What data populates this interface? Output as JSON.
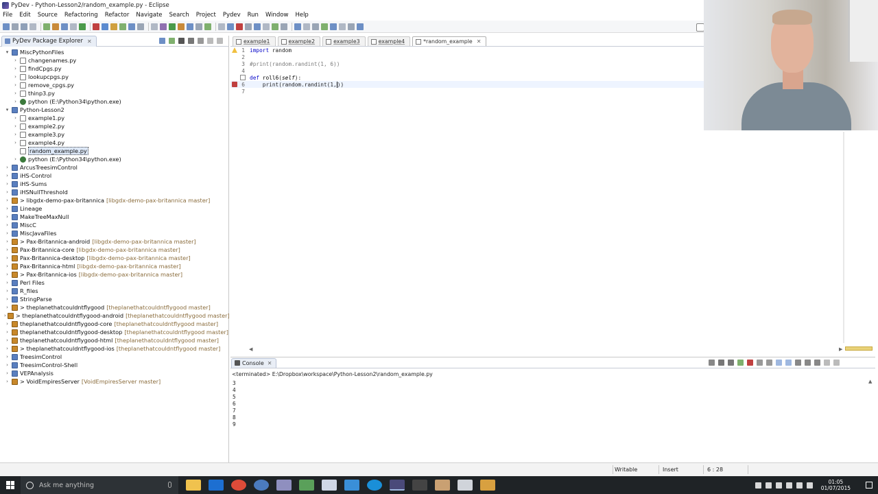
{
  "window": {
    "title": "PyDev - Python-Lesson2/random_example.py - Eclipse"
  },
  "menu": [
    "File",
    "Edit",
    "Source",
    "Refactoring",
    "Refactor",
    "Navigate",
    "Search",
    "Project",
    "Pydev",
    "Run",
    "Window",
    "Help"
  ],
  "explorer": {
    "tab_label": "PyDev Package Explorer",
    "close": "✕",
    "items": [
      {
        "label": "MiscPythonFiles",
        "type": "proj",
        "level": 0,
        "twisty": "▾",
        "branch": ""
      },
      {
        "label": "changenames.py",
        "type": "file",
        "level": 1,
        "twisty": "›",
        "branch": ""
      },
      {
        "label": "findCpgs.py",
        "type": "file",
        "level": 1,
        "twisty": "›",
        "branch": ""
      },
      {
        "label": "lookupcpgs.py",
        "type": "file",
        "level": 1,
        "twisty": "›",
        "branch": ""
      },
      {
        "label": "remove_cpgs.py",
        "type": "file",
        "level": 1,
        "twisty": "›",
        "branch": ""
      },
      {
        "label": "thinp3.py",
        "type": "file",
        "level": 1,
        "twisty": "›",
        "branch": ""
      },
      {
        "label": "python  (E:\\Python34\\python.exe)",
        "type": "interp",
        "level": 1,
        "twisty": "›",
        "branch": ""
      },
      {
        "label": "Python-Lesson2",
        "type": "proj",
        "level": 0,
        "twisty": "▾",
        "branch": ""
      },
      {
        "label": "example1.py",
        "type": "file",
        "level": 1,
        "twisty": "›",
        "branch": ""
      },
      {
        "label": "example2.py",
        "type": "file",
        "level": 1,
        "twisty": "›",
        "branch": ""
      },
      {
        "label": "example3.py",
        "type": "file",
        "level": 1,
        "twisty": "›",
        "branch": ""
      },
      {
        "label": "example4.py",
        "type": "file",
        "level": 1,
        "twisty": "›",
        "branch": ""
      },
      {
        "label": "random_example.py",
        "type": "file",
        "level": 1,
        "twisty": "",
        "branch": "",
        "selected": true
      },
      {
        "label": "python  (E:\\Python34\\python.exe)",
        "type": "interp",
        "level": 1,
        "twisty": "›",
        "branch": ""
      },
      {
        "label": "ArcusTreesimControl",
        "type": "proj",
        "level": 0,
        "twisty": "›",
        "branch": ""
      },
      {
        "label": "iHS-Control",
        "type": "proj",
        "level": 0,
        "twisty": "›",
        "branch": ""
      },
      {
        "label": "iHS-Sums",
        "type": "proj",
        "level": 0,
        "twisty": "›",
        "branch": ""
      },
      {
        "label": "iHSNullThreshold",
        "type": "proj",
        "level": 0,
        "twisty": "›",
        "branch": ""
      },
      {
        "label": "> libgdx-demo-pax-britannica",
        "type": "git",
        "level": 0,
        "twisty": "›",
        "branch": "[libgdx-demo-pax-britannica master]"
      },
      {
        "label": "Lineage",
        "type": "proj",
        "level": 0,
        "twisty": "›",
        "branch": ""
      },
      {
        "label": "MakeTreeMaxNull",
        "type": "proj",
        "level": 0,
        "twisty": "›",
        "branch": ""
      },
      {
        "label": "MiscC",
        "type": "proj",
        "level": 0,
        "twisty": "›",
        "branch": ""
      },
      {
        "label": "MiscJavaFiles",
        "type": "proj",
        "level": 0,
        "twisty": "›",
        "branch": ""
      },
      {
        "label": "> Pax-Britannica-android",
        "type": "git",
        "level": 0,
        "twisty": "›",
        "branch": "[libgdx-demo-pax-britannica master]"
      },
      {
        "label": "Pax-Britannica-core",
        "type": "git",
        "level": 0,
        "twisty": "›",
        "branch": "[libgdx-demo-pax-britannica master]"
      },
      {
        "label": "Pax-Britannica-desktop",
        "type": "git",
        "level": 0,
        "twisty": "›",
        "branch": "[libgdx-demo-pax-britannica master]"
      },
      {
        "label": "Pax-Britannica-html",
        "type": "git",
        "level": 0,
        "twisty": "›",
        "branch": "[libgdx-demo-pax-britannica master]"
      },
      {
        "label": "> Pax-Britannica-ios",
        "type": "git",
        "level": 0,
        "twisty": "›",
        "branch": "[libgdx-demo-pax-britannica master]"
      },
      {
        "label": "Perl Files",
        "type": "proj",
        "level": 0,
        "twisty": "›",
        "branch": ""
      },
      {
        "label": "R_files",
        "type": "proj",
        "level": 0,
        "twisty": "›",
        "branch": ""
      },
      {
        "label": "StringParse",
        "type": "proj",
        "level": 0,
        "twisty": "›",
        "branch": ""
      },
      {
        "label": "> theplanethatcouldntflygood",
        "type": "git",
        "level": 0,
        "twisty": "›",
        "branch": "[theplanethatcouldntflygood master]"
      },
      {
        "label": "> theplanethatcouldntflygood-android",
        "type": "git",
        "level": 0,
        "twisty": "›",
        "branch": "[theplanethatcouldntflygood master]"
      },
      {
        "label": "theplanethatcouldntflygood-core",
        "type": "git",
        "level": 0,
        "twisty": "›",
        "branch": "[theplanethatcouldntflygood master]"
      },
      {
        "label": "theplanethatcouldntflygood-desktop",
        "type": "git",
        "level": 0,
        "twisty": "›",
        "branch": "[theplanethatcouldntflygood master]"
      },
      {
        "label": "theplanethatcouldntflygood-html",
        "type": "git",
        "level": 0,
        "twisty": "›",
        "branch": "[theplanethatcouldntflygood master]"
      },
      {
        "label": "> theplanethatcouldntflygood-ios",
        "type": "git",
        "level": 0,
        "twisty": "›",
        "branch": "[theplanethatcouldntflygood master]"
      },
      {
        "label": "TreesimControl",
        "type": "proj",
        "level": 0,
        "twisty": "›",
        "branch": ""
      },
      {
        "label": "TreesimControl-Shell",
        "type": "proj",
        "level": 0,
        "twisty": "›",
        "branch": ""
      },
      {
        "label": "VEPAnalysis",
        "type": "proj",
        "level": 0,
        "twisty": "›",
        "branch": ""
      },
      {
        "label": "> VoidEmpiresServer",
        "type": "git",
        "level": 0,
        "twisty": "›",
        "branch": "[VoidEmpiresServer master]"
      }
    ]
  },
  "editor": {
    "tabs": [
      {
        "label": "example1",
        "active": false
      },
      {
        "label": "example2",
        "active": false
      },
      {
        "label": "example3",
        "active": false
      },
      {
        "label": "example4",
        "active": false
      },
      {
        "label": "*random_example",
        "active": true
      }
    ],
    "close": "✕",
    "lines": [
      {
        "num": "1",
        "html": "<span class='kw'>import</span> random",
        "mark": "warn"
      },
      {
        "num": "2",
        "html": "",
        "mark": ""
      },
      {
        "num": "3",
        "html": "<span class='cm'>#print(random.randint(1, 6))</span>",
        "mark": ""
      },
      {
        "num": "4",
        "html": "",
        "mark": ""
      },
      {
        "num": "5",
        "html": "<span class='kw'>def</span> <span class='fn'>roll6</span>(<span class='selfkw'>self</span>):",
        "mark": "fold"
      },
      {
        "num": "6",
        "html": "    print(random.randint(1,<span style='border-left:1px solid #000'>)</span>)",
        "mark": "err",
        "current": true
      },
      {
        "num": "7",
        "html": "",
        "mark": ""
      }
    ]
  },
  "console": {
    "tab_label": "Console",
    "close": "✕",
    "header": "<terminated> E:\\Dropbox\\workspace\\Python-Lesson2\\random_example.py",
    "output": [
      "3",
      "4",
      "5",
      "6",
      "7",
      "8",
      "9"
    ]
  },
  "status": {
    "writable": "Writable",
    "insert": "Insert",
    "position": "6 : 28"
  },
  "taskbar": {
    "search_placeholder": "Ask me anything",
    "time": "01:05",
    "date": "01/07/2015"
  }
}
